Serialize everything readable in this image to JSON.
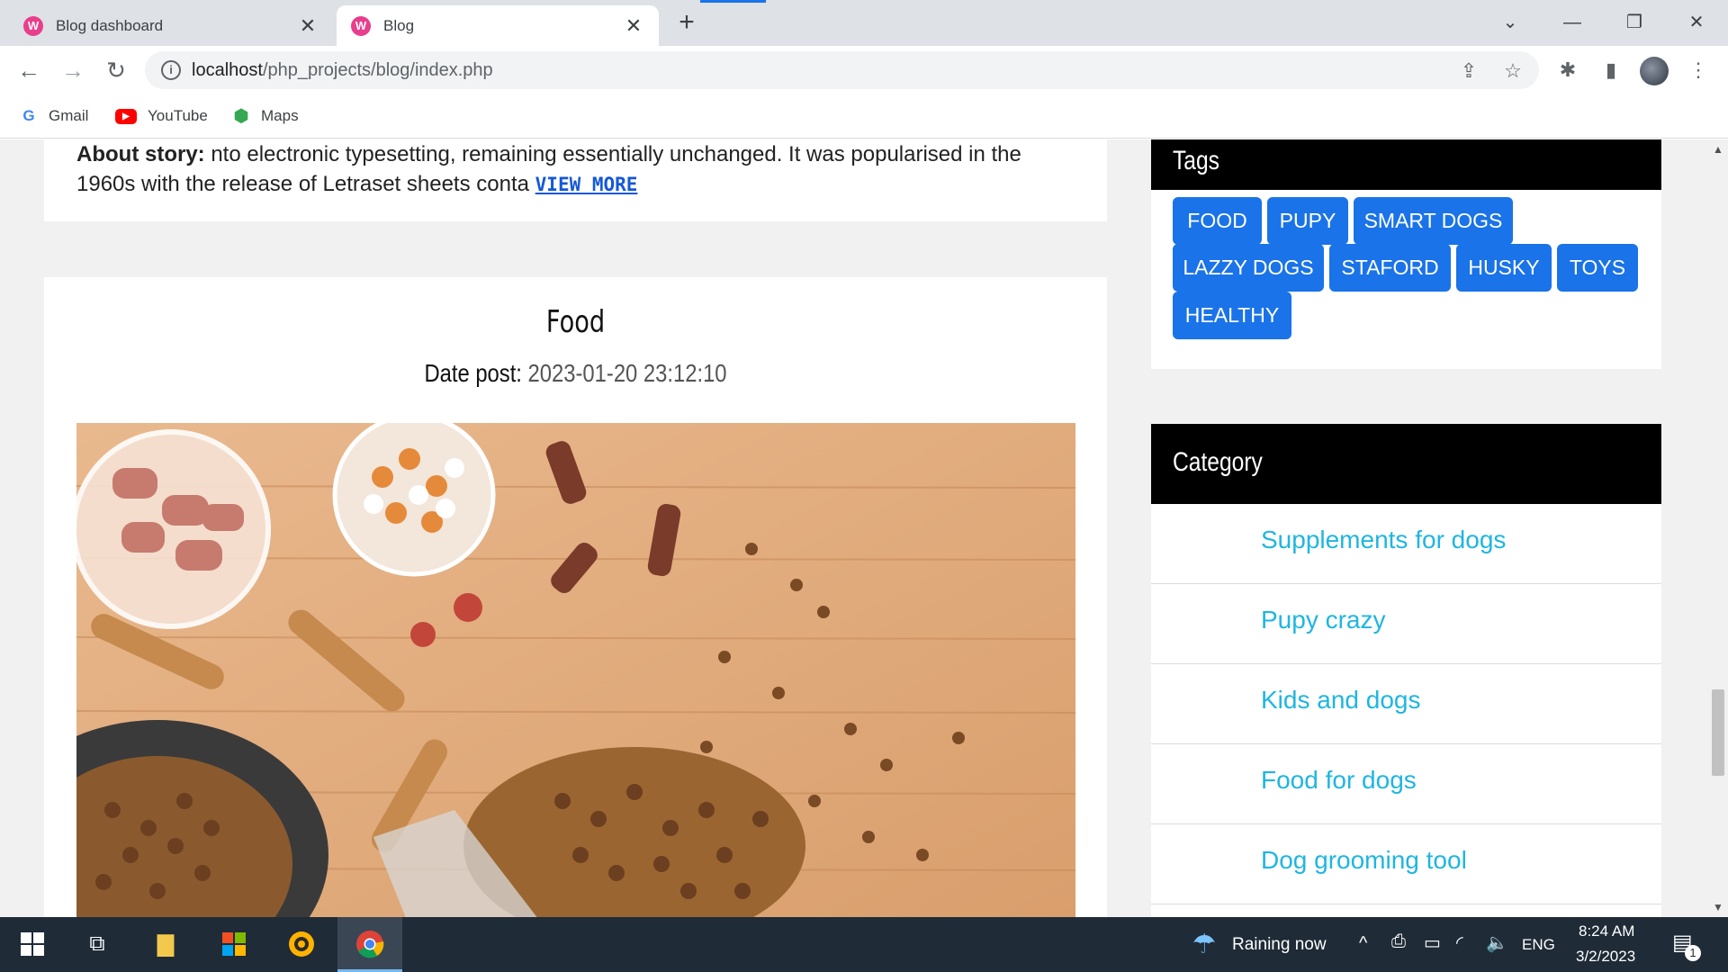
{
  "browser": {
    "tabs": [
      {
        "title": "Blog dashboard",
        "favicon": "W",
        "active": false
      },
      {
        "title": "Blog",
        "favicon": "W",
        "active": true
      }
    ],
    "address": {
      "host": "localhost",
      "path": "/php_projects/blog/index.php"
    },
    "bookmarks": [
      {
        "label": "Gmail",
        "icon": "google-icon"
      },
      {
        "label": "YouTube",
        "icon": "youtube-icon"
      },
      {
        "label": "Maps",
        "icon": "maps-icon"
      }
    ]
  },
  "page": {
    "previous_post": {
      "label": "About story:",
      "text": " nto electronic typesetting, remaining essentially unchanged. It was popularised in the 1960s with the release of Letraset sheets conta ",
      "view_more": "VIEW MORE"
    },
    "post": {
      "title": "Food",
      "date_label": "Date post:",
      "date_value": " 2023-01-20 23:12:10",
      "image": "dog-food-on-wooden-table"
    },
    "tags_widget": {
      "title": "Tags",
      "tags": [
        "FOOD",
        "PUPY",
        "SMART DOGS",
        "LAZZY DOGS",
        "STAFORD",
        "HUSKY",
        "TOYS",
        "HEALTHY"
      ]
    },
    "category_widget": {
      "title": "Category",
      "items": [
        "Supplements for dogs",
        "Pupy crazy",
        "Kids and dogs",
        "Food for dogs",
        "Dog grooming tool"
      ]
    }
  },
  "taskbar": {
    "weather": "Raining now",
    "language": "ENG",
    "time": "8:24 AM",
    "date": "3/2/2023",
    "notification_count": "1"
  },
  "colors": {
    "tag_bg": "#1a73e8",
    "category_link": "#1fb6e0",
    "widget_head": "#000000"
  }
}
